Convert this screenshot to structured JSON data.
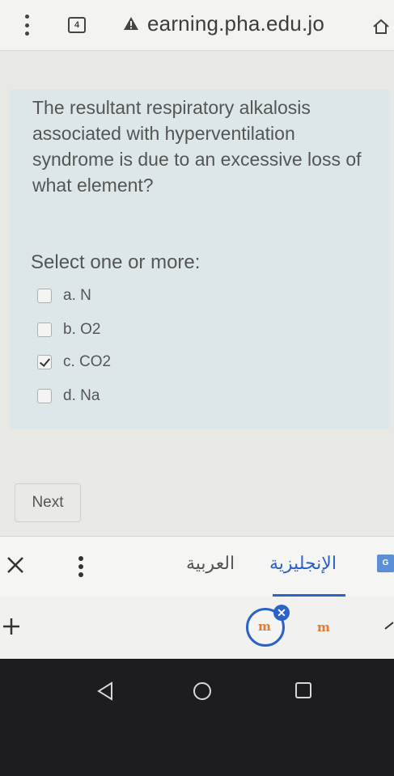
{
  "browser": {
    "url": "earning.pha.edu.jo",
    "tab_count": "4",
    "icons": [
      "more-vert-icon",
      "tab-count-icon",
      "warning-icon",
      "home-icon"
    ]
  },
  "quiz": {
    "question": "The resultant respiratory alkalosis associated with hyperventilation syndrome is due to an excessive loss of what element?",
    "prompt": "Select one or more:",
    "options": [
      {
        "label": "a. N",
        "checked": false
      },
      {
        "label": "b. O2",
        "checked": false
      },
      {
        "label": "c. CO2",
        "checked": true
      },
      {
        "label": "d. Na",
        "checked": false
      }
    ],
    "next_label": "Next"
  },
  "translate_bar": {
    "source_language": "العربية",
    "target_language": "الإنجليزية",
    "badge": "G"
  },
  "bubbles": {
    "app_icon_text": "m",
    "close_glyph": "✕"
  },
  "colors": {
    "card_background": "#dde7ea",
    "accent": "#2a62c9",
    "nav_background": "#1d1d1f"
  }
}
